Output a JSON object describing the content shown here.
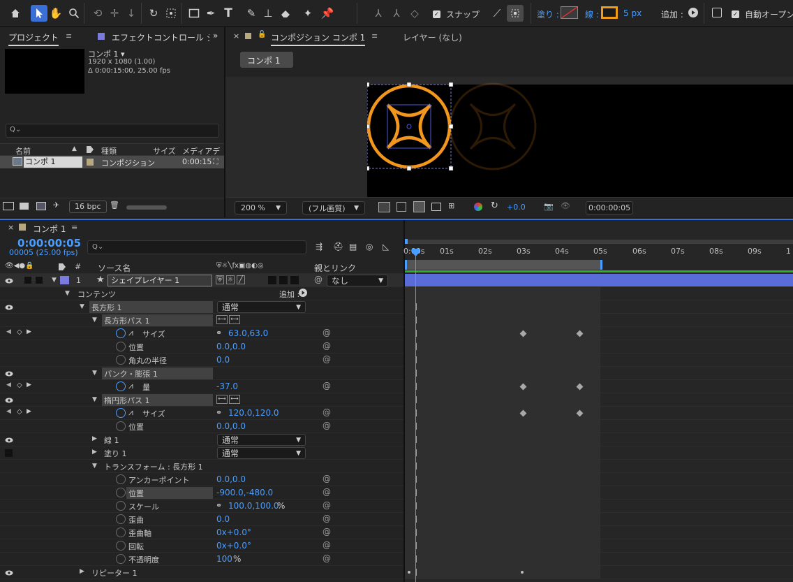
{
  "toolbar": {
    "snap_label": "スナップ",
    "fill_label": "塗り :",
    "stroke_label": "線 :",
    "stroke_width": "5 px",
    "add_label": "追加 :",
    "auto_open_label": "自動オープン"
  },
  "project": {
    "tab_label": "プロジェクト",
    "effect_tab_label": "エフェクトコントロール シ",
    "comp_name": "コンポ 1 ▾",
    "comp_size": "1920 x 1080 (1.00)",
    "comp_duration": "Δ 0:00:15:00, 25.00 fps",
    "search_icon": "Q⌄",
    "col_name": "名前",
    "col_type": "種類",
    "col_size": "サイズ",
    "col_media": "メディアデ",
    "row_name": "コンポ 1",
    "row_type": "コンポジション",
    "row_duration": "0:00:15",
    "bpc": "16 bpc"
  },
  "viewer": {
    "tab_label": "コンポジション コンポ 1",
    "layer_tab_label": "レイヤー (なし)",
    "comp_button": "コンポ 1",
    "zoom": "200 %",
    "quality": "(フル画質)",
    "exposure": "+0.0",
    "timecode": "0:00:00:05"
  },
  "timeline": {
    "comp_tab": "コンポ 1",
    "timecode": "0:00:00:05",
    "frame_fps": "00005 (25.00 fps)",
    "search_icon": "Q⌄",
    "col_num": "#",
    "col_source": "ソース名",
    "col_parent": "親とリンク",
    "ruler": [
      "0:00s",
      "01s",
      "02s",
      "03s",
      "04s",
      "05s",
      "06s",
      "07s",
      "08s",
      "09s",
      "1"
    ],
    "layer": {
      "num": "1",
      "name": "シェイプレイヤー 1",
      "parent": "なし"
    },
    "contents": "コンテンツ",
    "add": "追加 :",
    "rect_group": "長方形 1",
    "rect_group_mode": "通常",
    "rect_path": "長方形パス 1",
    "size_label": "サイズ",
    "size_value": "63.0,63.0",
    "position_label": "位置",
    "position_value": "0.0,0.0",
    "roundness_label": "角丸の半径",
    "roundness_value": "0.0",
    "pucker": "パンク・膨張 1",
    "amount_label": "量",
    "amount_value": "-37.0",
    "ellipse_path": "楕円形パス 1",
    "ellipse_size_label": "サイズ",
    "ellipse_size_value": "120.0,120.0",
    "ellipse_pos_label": "位置",
    "ellipse_pos_value": "0.0,0.0",
    "stroke": "線 1",
    "stroke_mode": "通常",
    "fill": "塗り 1",
    "fill_mode": "通常",
    "transform": "トランスフォーム : 長方形 1",
    "anchor_label": "アンカーポイント",
    "anchor_value": "0.0,0.0",
    "t_position_label": "位置",
    "t_position_value": "-900.0,-480.0",
    "scale_label": "スケール",
    "scale_value": "100.0,100.0",
    "scale_unit": "%",
    "skew_label": "歪曲",
    "skew_value": "0.0",
    "skew_axis_label": "歪曲軸",
    "skew_axis_value": "0x+0.0°",
    "rotation_label": "回転",
    "rotation_value": "0x+0.0°",
    "opacity_label": "不透明度",
    "opacity_value": "100",
    "opacity_unit": "%",
    "repeater": "リピーター 1"
  }
}
